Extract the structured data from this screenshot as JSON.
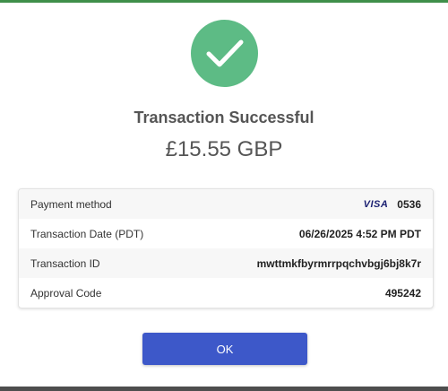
{
  "status": {
    "title": "Transaction Successful",
    "amount": "£15.55 GBP",
    "icon": "checkmark-icon",
    "color": "#5dbb85"
  },
  "details": {
    "payment_method": {
      "label": "Payment method",
      "brand": "VISA",
      "last4": "0536"
    },
    "transaction_date": {
      "label": "Transaction Date (PDT)",
      "value": "06/26/2025 4:52 PM PDT"
    },
    "transaction_id": {
      "label": "Transaction ID",
      "value": "mwttmkfbyrmrrpqchvbgj6bj8k7r"
    },
    "approval_code": {
      "label": "Approval Code",
      "value": "495242"
    }
  },
  "actions": {
    "ok_label": "OK",
    "accent": "#3d58c9"
  }
}
